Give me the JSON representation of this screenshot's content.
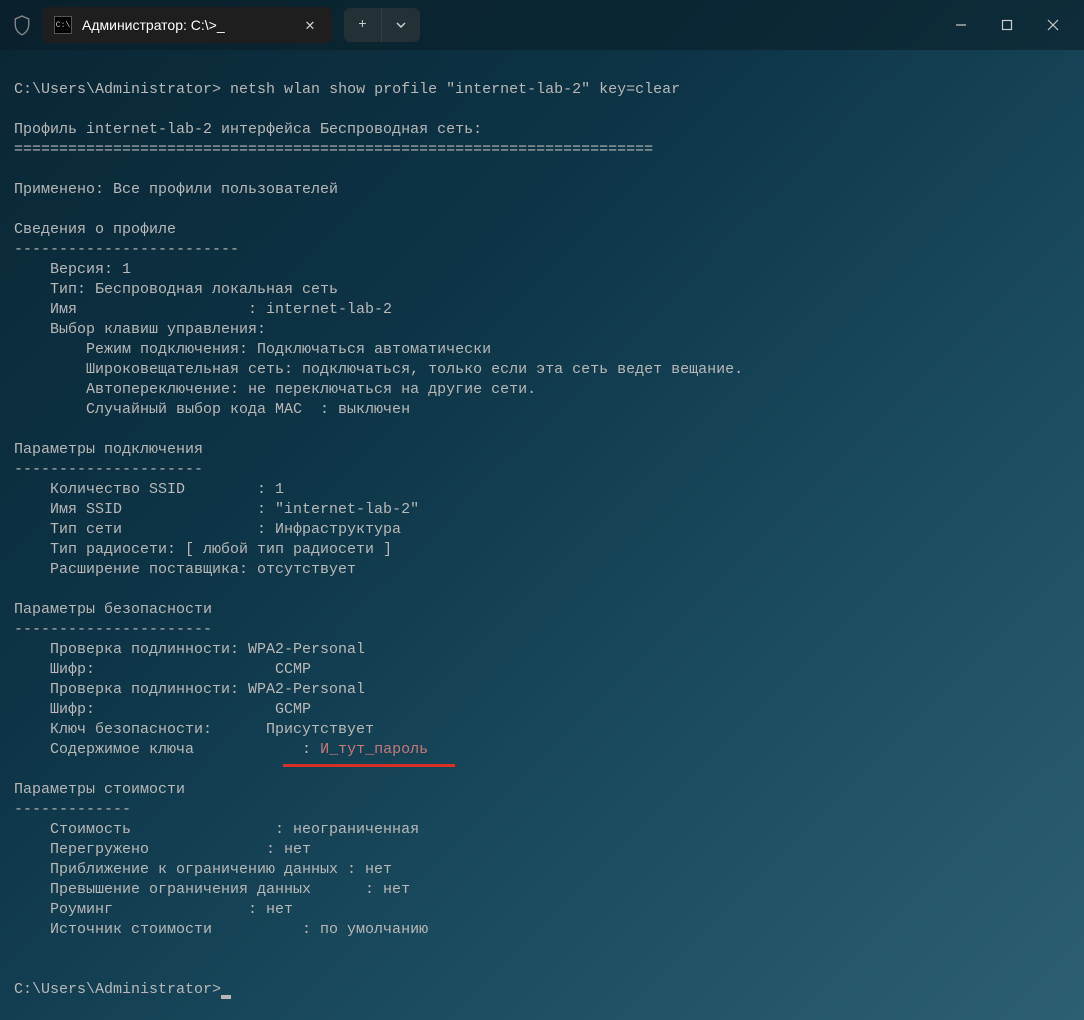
{
  "titlebar": {
    "tab_title": "Администратор: C:\\>_",
    "tab_icon_text": "C:\\"
  },
  "terminal": {
    "prompt1": "C:\\Users\\Administrator> ",
    "command": "netsh wlan show profile \"internet-lab-2\" key=clear",
    "line_blank": "",
    "profile_header": "Профиль internet-lab-2 интерфейса Беспроводная сеть:",
    "divider70": "=======================================================================",
    "applied": "Применено: Все профили пользователей",
    "section_profile": "Сведения о профиле",
    "dash26": "-------------------------",
    "version": "    Версия: 1",
    "type": "    Тип: Беспроводная локальная сеть",
    "name": "    Имя                   : internet-lab-2",
    "keysel": "    Выбор клавиш управления:",
    "conn_mode": "        Режим подключения: Подключаться автоматически",
    "broadcast": "        Широковещательная сеть: подключаться, только если эта сеть ведет вещание.",
    "autoswitch": "        Автопереключение: не переключаться на другие сети.",
    "macrand": "        Случайный выбор кода MAC  : выключен",
    "section_conn": "Параметры подключения",
    "dash21": "---------------------",
    "ssid_count": "    Количество SSID        : 1",
    "ssid_name": "    Имя SSID               : \"internet-lab-2\"",
    "net_type": "    Тип сети               : Инфраструктура",
    "radio_type": "    Тип радиосети: [ любой тип радиосети ]",
    "vendor_ext": "    Расширение поставщика: отсутствует",
    "section_sec": "Параметры безопасности",
    "dash22": "----------------------",
    "auth1": "    Проверка подлинности: WPA2-Personal",
    "cipher1": "    Шифр:                    CCMP",
    "auth2": "    Проверка подлинности: WPA2-Personal",
    "cipher2": "    Шифр:                    GCMP",
    "seckey": "    Ключ безопасности:      Присутствует",
    "keycontent_label": "    Содержимое ключа            : ",
    "keycontent_value": "И_тут_пароль",
    "section_cost": "Параметры стоимости",
    "dash13": "-------------",
    "cost": "    Стоимость                : неограниченная",
    "congested": "    Перегружено             : нет",
    "approaching": "    Приближение к ограничению данных : нет",
    "over_limit": "    Превышение ограничения данных      : нет",
    "roaming": "    Роуминг               : нет",
    "cost_source": "    Источник стоимости          : по умолчанию",
    "prompt2": "C:\\Users\\Administrator>"
  }
}
